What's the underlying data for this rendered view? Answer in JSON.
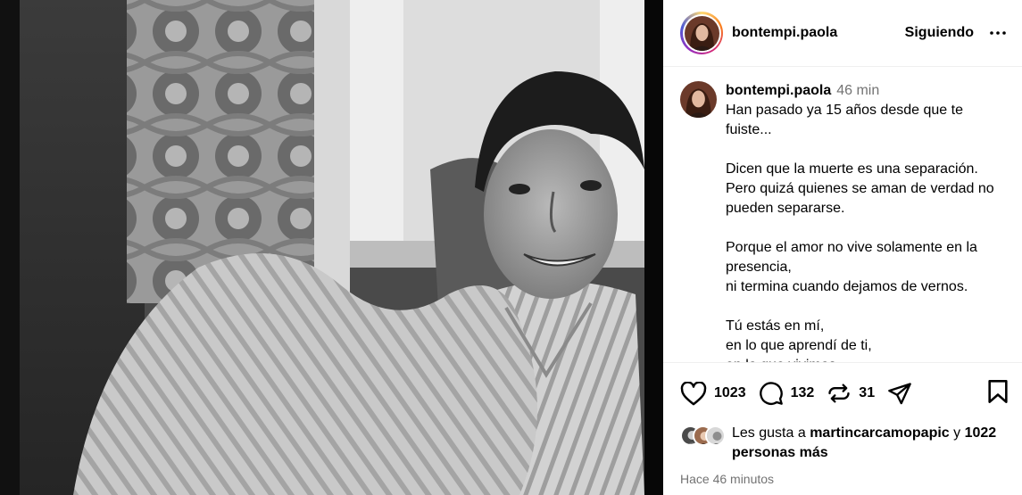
{
  "post": {
    "username": "bontempi.paola",
    "follow_label": "Siguiendo"
  },
  "caption": {
    "username": "bontempi.paola",
    "time": "46 min",
    "paragraphs": [
      [
        "Han pasado ya 15 años desde que te fuiste..."
      ],
      [
        "Dicen que la muerte es una separación.",
        "Pero quizá quienes se aman de verdad no pueden separarse."
      ],
      [
        "Porque el amor no vive solamente en la presencia,",
        "ni termina cuando dejamos de vernos."
      ],
      [
        "Tú estás en mí,",
        "en lo que aprendí de ti,",
        "en lo que vivimos"
      ]
    ]
  },
  "actions": {
    "likes": "1023",
    "comments": "132",
    "reposts": "31"
  },
  "likes_summary": {
    "prefix": "Les gusta a",
    "user": "martincarcamopapic",
    "connector": "y",
    "others": "1022 personas más"
  },
  "posted_ago": "Hace 46 minutos",
  "colors": {
    "text": "#000000",
    "muted": "#737373",
    "divider": "#efefef"
  }
}
